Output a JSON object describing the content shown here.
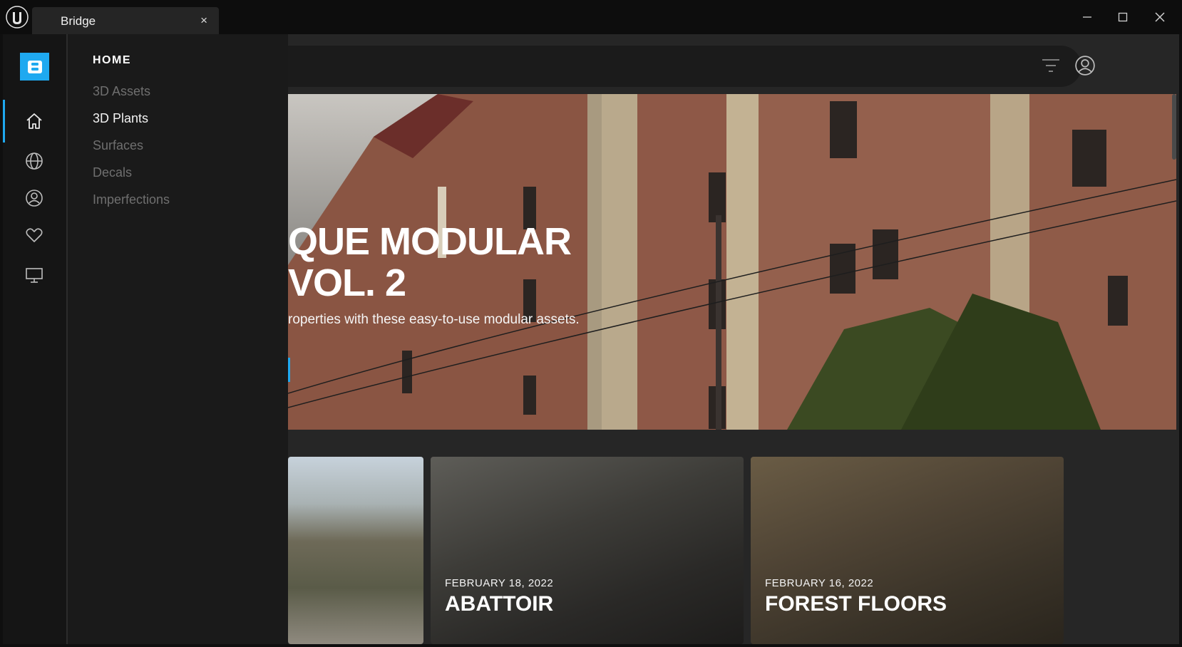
{
  "window": {
    "tab_title": "Bridge",
    "tab_close": "×"
  },
  "rail": {
    "logo_letter": "B",
    "icons": [
      "home-icon",
      "globe-icon",
      "user-icon",
      "heart-icon",
      "monitor-icon"
    ],
    "active": "home"
  },
  "drawer": {
    "heading": "HOME",
    "items": [
      {
        "label": "3D Assets",
        "active": false
      },
      {
        "label": "3D Plants",
        "active": true
      },
      {
        "label": "Surfaces",
        "active": false
      },
      {
        "label": "Decals",
        "active": false
      },
      {
        "label": "Imperfections",
        "active": false
      }
    ]
  },
  "hero": {
    "title_line1": "QUE MODULAR",
    "title_line2": "VOL. 2",
    "subtitle": "roperties with these easy-to-use modular assets."
  },
  "cards": [
    {
      "date": "",
      "title": ""
    },
    {
      "date": "FEBRUARY 18, 2022",
      "title": "ABATTOIR"
    },
    {
      "date": "FEBRUARY 16, 2022",
      "title": "FOREST FLOORS"
    }
  ],
  "colors": {
    "accent": "#1fa9f0",
    "rail_bg": "#151515",
    "drawer_bg": "#1a1a1a",
    "content_bg": "#262626"
  }
}
